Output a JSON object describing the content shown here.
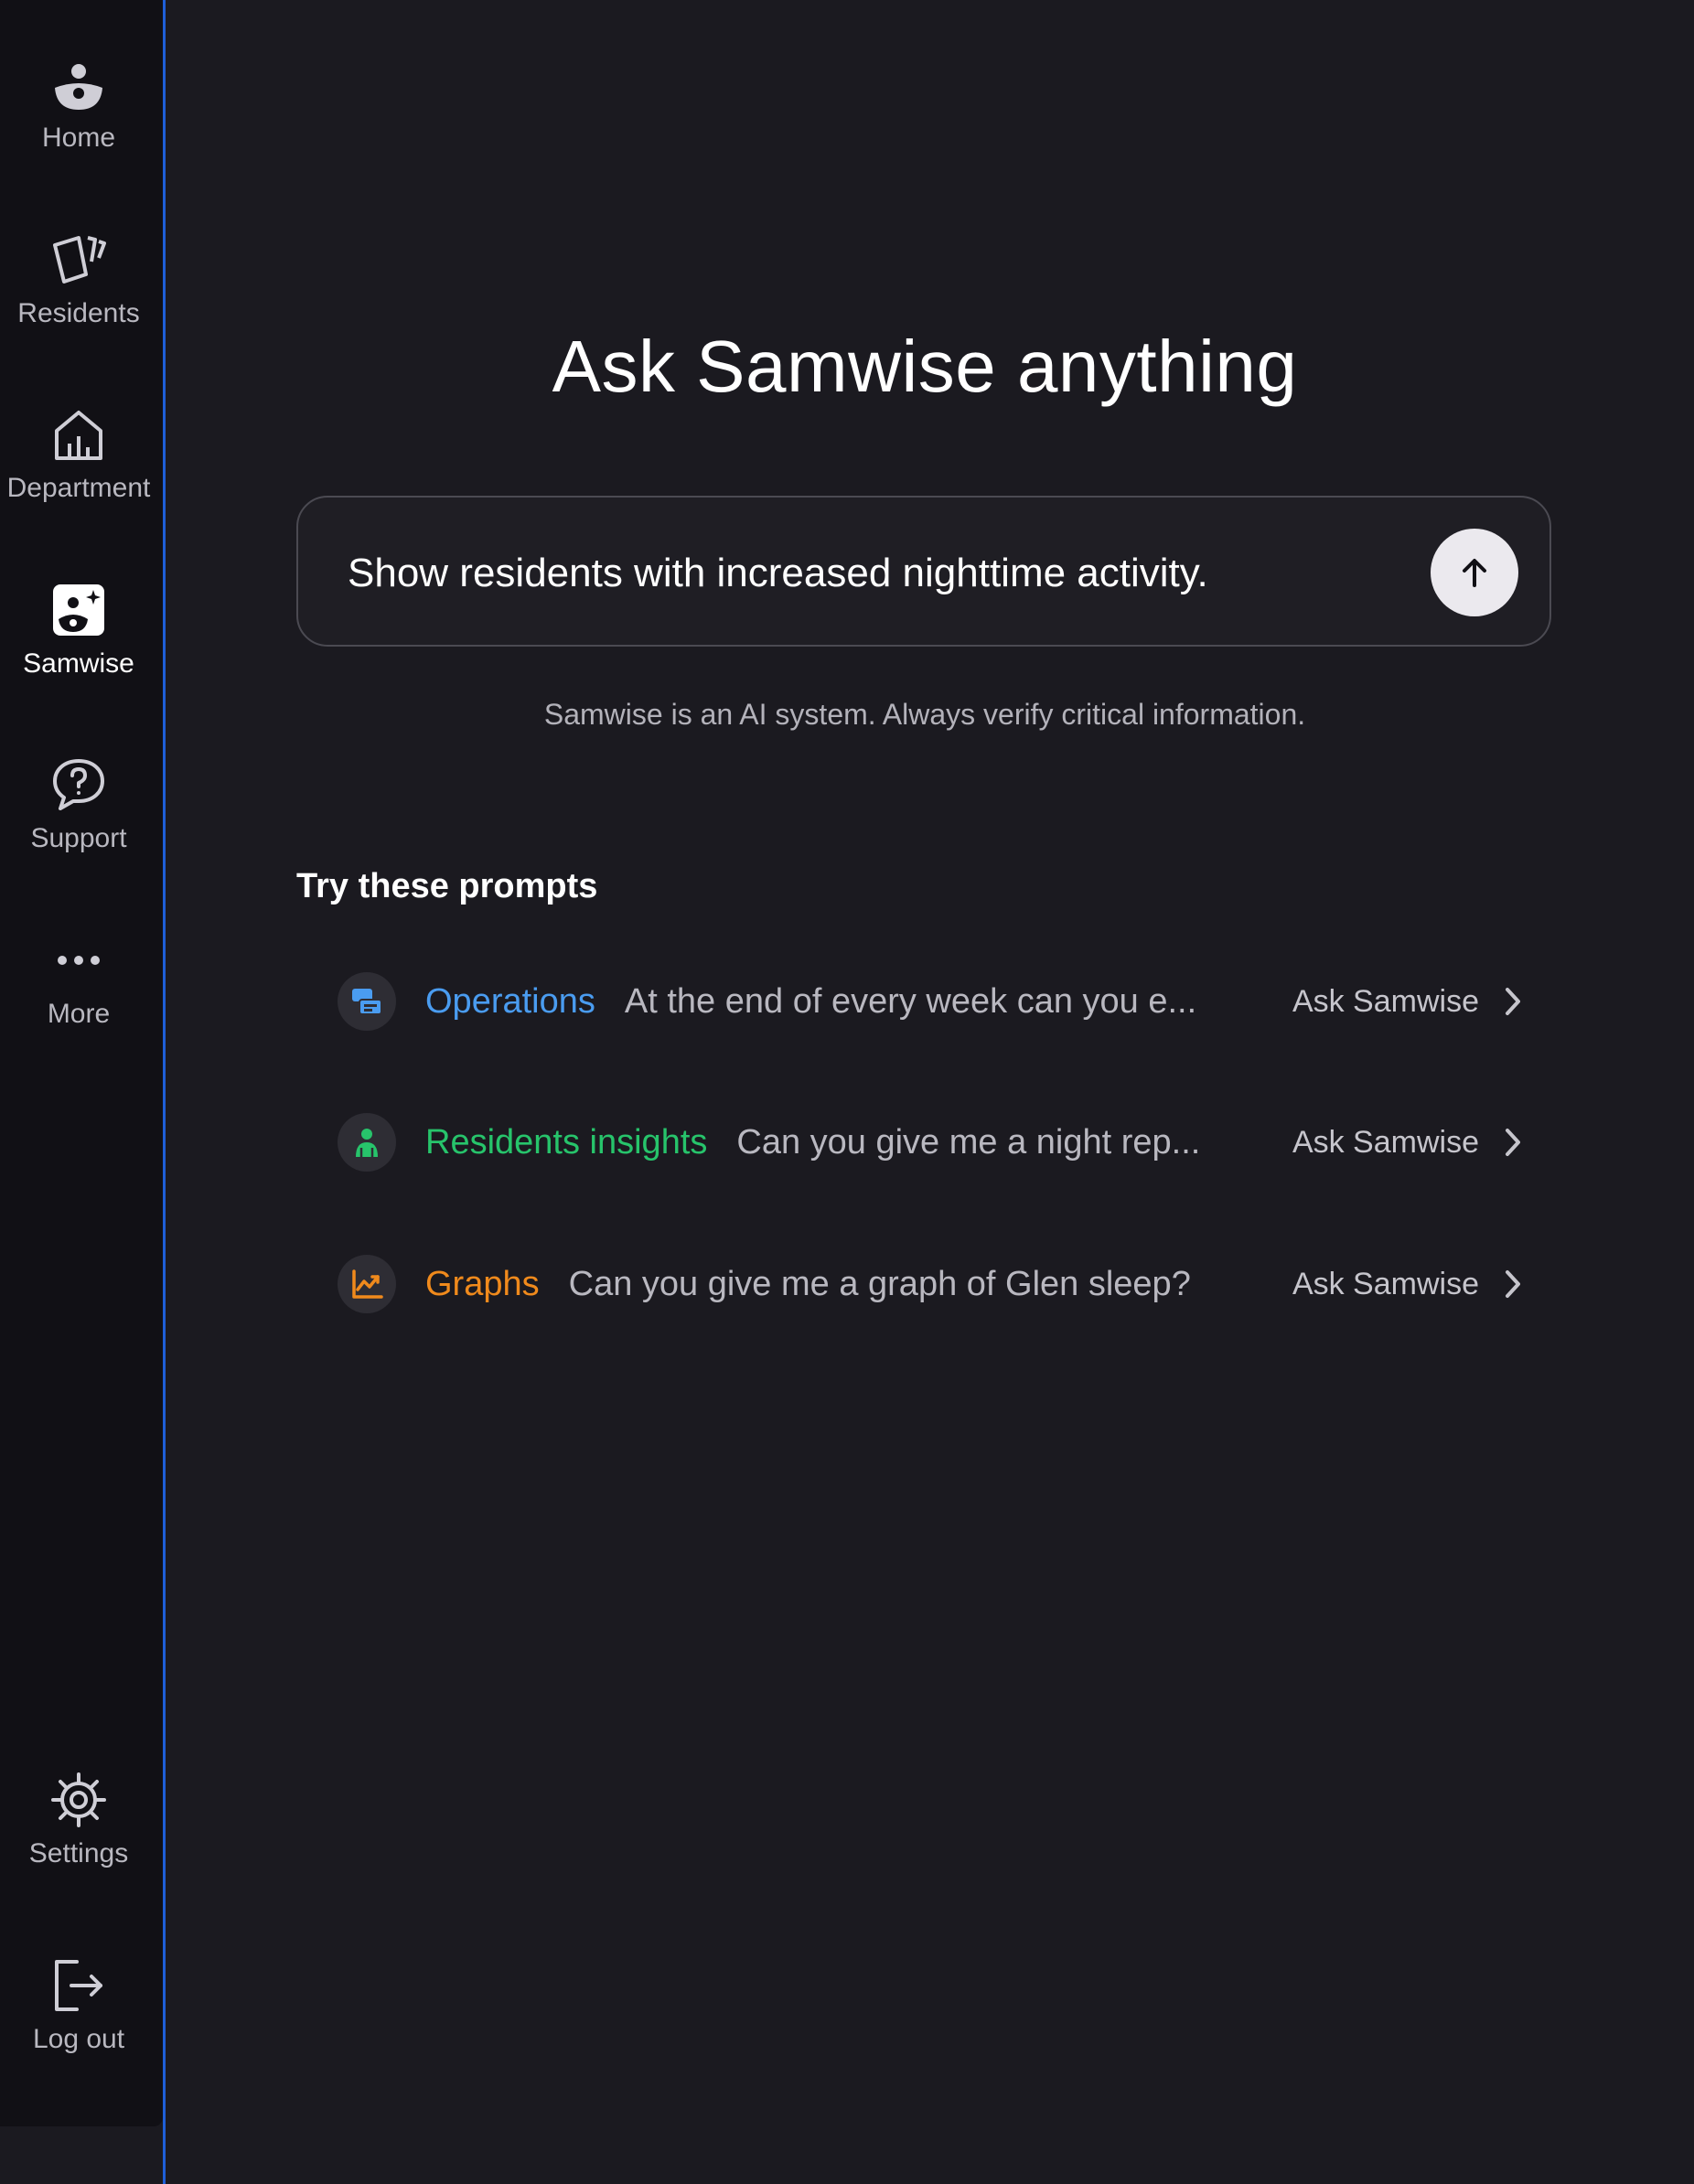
{
  "sidebar": {
    "items": [
      {
        "label": "Home",
        "icon": "home-icon"
      },
      {
        "label": "Residents",
        "icon": "residents-icon"
      },
      {
        "label": "Department",
        "icon": "department-icon"
      },
      {
        "label": "Samwise",
        "icon": "samwise-icon",
        "active": true
      },
      {
        "label": "Support",
        "icon": "support-icon"
      },
      {
        "label": "More",
        "icon": "more-icon"
      }
    ],
    "bottom_items": [
      {
        "label": "Settings",
        "icon": "gear-icon"
      },
      {
        "label": "Log out",
        "icon": "logout-icon"
      }
    ]
  },
  "main": {
    "title": "Ask Samwise anything",
    "chat": {
      "value": "Show residents with increased nighttime activity.",
      "send_icon": "arrow-up-icon"
    },
    "disclaimer": "Samwise is an AI system. Always verify critical information.",
    "prompts_title": "Try these prompts",
    "prompts": [
      {
        "category": "Operations",
        "text": "At the end of every week can you e...",
        "action": "Ask Samwise",
        "color": "#4a9cf0",
        "icon": "operations-icon"
      },
      {
        "category": "Residents insights",
        "text": "Can you give me a night rep...",
        "action": "Ask Samwise",
        "color": "#27c46b",
        "icon": "resident-insights-icon"
      },
      {
        "category": "Graphs",
        "text": "Can you give me a graph of Glen sleep?",
        "action": "Ask Samwise",
        "color": "#f08a1c",
        "icon": "graph-icon"
      }
    ]
  },
  "colors": {
    "background": "#1b1a20",
    "sidebar": "#111015",
    "accent": "#1f5fd8"
  }
}
